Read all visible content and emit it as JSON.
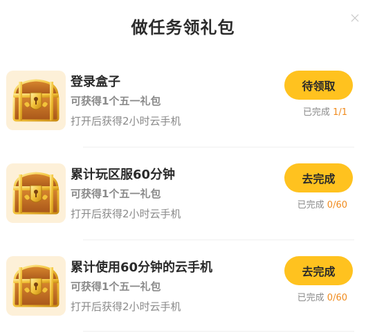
{
  "dialog": {
    "title": "做任务领礼包"
  },
  "tasks": [
    {
      "name": "登录盒子",
      "reward": "可获得1个五一礼包",
      "desc": "打开后获得2小时云手机",
      "button": "待领取",
      "progress_label": "已完成",
      "progress_count": "1/1",
      "icon": "treasure-chest-icon"
    },
    {
      "name": "累计玩区服60分钟",
      "reward": "可获得1个五一礼包",
      "desc": "打开后获得2小时云手机",
      "button": "去完成",
      "progress_label": "已完成",
      "progress_count": "0/60",
      "icon": "treasure-chest-icon"
    },
    {
      "name": "累计使用60分钟的云手机",
      "reward": "可获得1个五一礼包",
      "desc": "打开后获得2小时云手机",
      "button": "去完成",
      "progress_label": "已完成",
      "progress_count": "0/60",
      "icon": "treasure-chest-icon"
    }
  ],
  "colors": {
    "button": "#ffc21f",
    "count": "#f08a1c",
    "chest_bg": "#fdf0d8"
  }
}
